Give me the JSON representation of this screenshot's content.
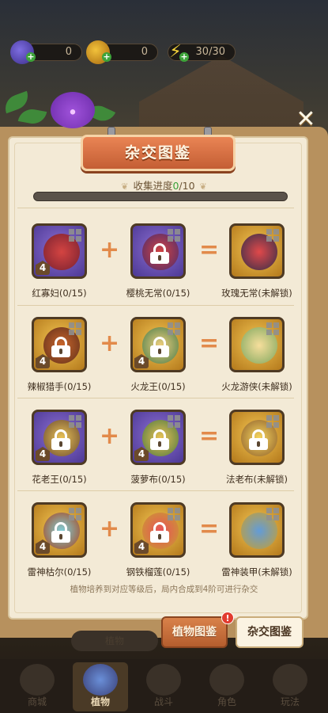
{
  "topbar": {
    "resources": [
      {
        "icon": "gem-icon",
        "value": "0"
      },
      {
        "icon": "coin-icon",
        "value": "0"
      },
      {
        "icon": "lightning-icon",
        "value": "30/30"
      }
    ]
  },
  "dialog": {
    "title": "杂交图鉴",
    "progress_label_prefix": "收集进度",
    "progress_current": "0",
    "progress_total": "/10",
    "progress_fraction": 0,
    "hint": "植物培养到对应等级后，局内合成到4阶可进行杂交"
  },
  "recipes": [
    {
      "a": "红寡妇(0/15)",
      "b": "樱桃无常(0/15)",
      "result": "玫瑰无常(未解锁)",
      "a_color": "purple",
      "b_color": "purple",
      "r_color": "gold"
    },
    {
      "a": "辣椒猎手(0/15)",
      "b": "火龙王(0/15)",
      "result": "火龙游侠(未解锁)",
      "a_color": "gold",
      "b_color": "gold",
      "r_color": "gold"
    },
    {
      "a": "花老王(0/15)",
      "b": "菠萝布(0/15)",
      "result": "法老布(未解锁)",
      "a_color": "purple",
      "b_color": "purple",
      "r_color": "gold"
    },
    {
      "a": "雷神枯尔(0/15)",
      "b": "钢铁榴莲(0/15)",
      "result": "雷神装甲(未解锁)",
      "a_color": "gold",
      "b_color": "gold",
      "r_color": "gold"
    }
  ],
  "operators": {
    "plus": "+",
    "equals": "="
  },
  "level_badge": "4",
  "tabs": {
    "plant_guide": "植物图鉴",
    "hybrid_guide": "杂交图鉴",
    "badge": "!"
  },
  "under_label": "植物",
  "close": "✕",
  "bottom_nav": [
    {
      "label": "商城"
    },
    {
      "label": "植物"
    },
    {
      "label": "战斗"
    },
    {
      "label": "角色"
    },
    {
      "label": "玩法"
    }
  ]
}
